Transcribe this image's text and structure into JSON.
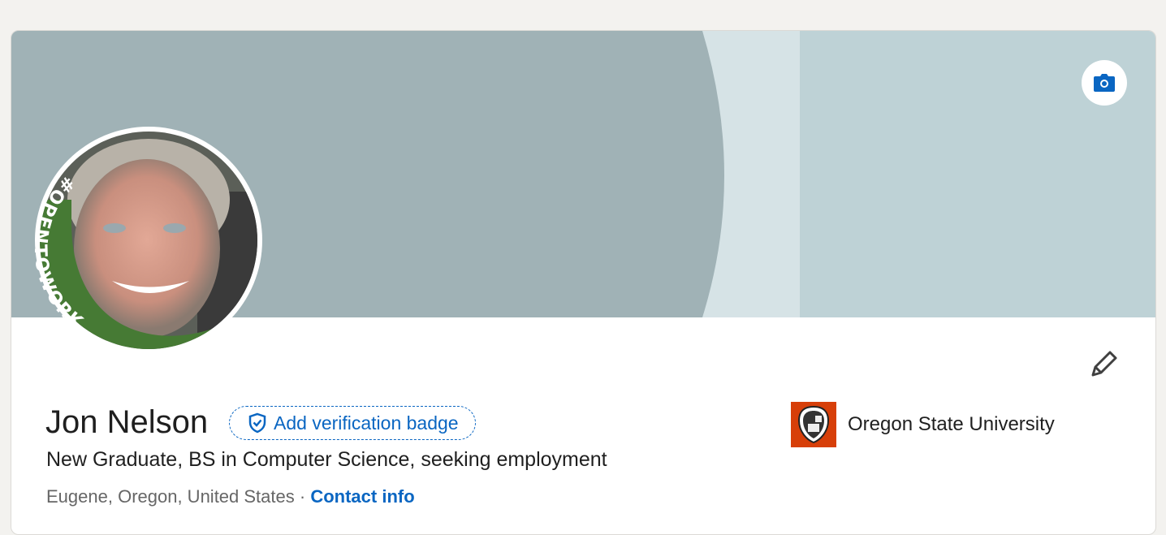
{
  "profile": {
    "name": "Jon Nelson",
    "verification_label": "Add verification badge",
    "headline": "New Graduate, BS in Computer Science, seeking employment",
    "location": "Eugene, Oregon, United States",
    "separator": "·",
    "contact_label": "Contact info",
    "open_to_work_frame": "#OPENTOWORK"
  },
  "education": {
    "school": "Oregon State University"
  },
  "colors": {
    "accent": "#0a66c2",
    "banner_dark": "#a0b2b6",
    "banner_light": "#bed2d6",
    "frame_green": "#467a34",
    "school_orange": "#d73f09"
  }
}
